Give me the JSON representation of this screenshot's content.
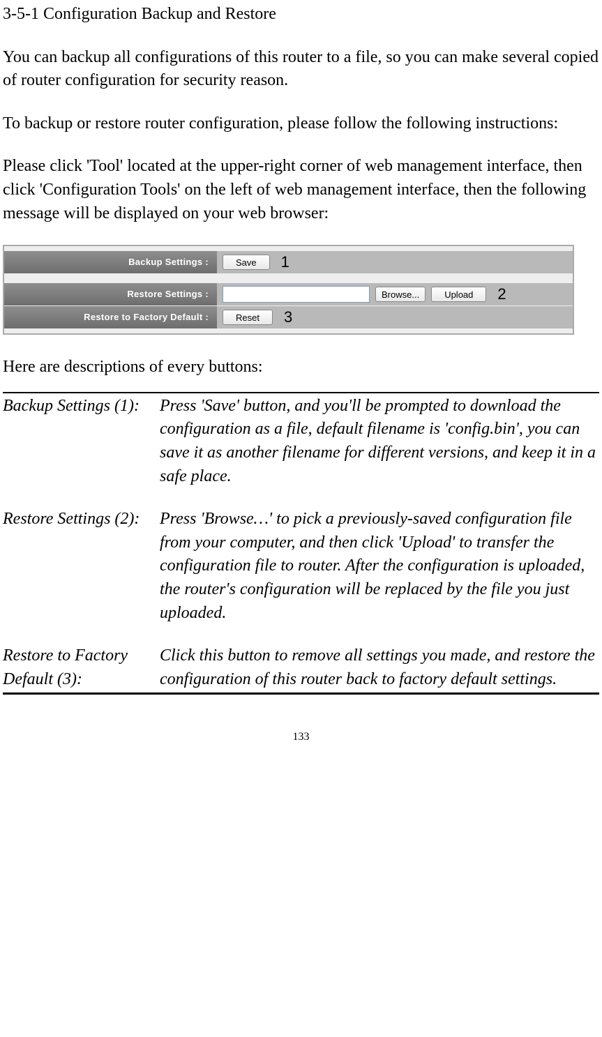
{
  "title": "3-5-1 Configuration Backup and Restore",
  "paragraphs": {
    "p1": "You can backup all configurations of this router to a file, so you can make several copied of router configuration for security reason.",
    "p2": "To backup or restore router configuration, please follow the following instructions:",
    "p3": "Please click 'Tool' located at the upper-right corner of web management interface, then click 'Configuration Tools' on the left of web management interface, then the following message will be displayed on your web browser:"
  },
  "ui": {
    "backup_label": "Backup Settings :",
    "restore_label": "Restore Settings :",
    "factory_label": "Restore to Factory Default :",
    "save_btn": "Save",
    "browse_btn": "Browse...",
    "upload_btn": "Upload",
    "reset_btn": "Reset",
    "marker1": "1",
    "marker2": "2",
    "marker3": "3"
  },
  "desc_intro": "Here are descriptions of every buttons:",
  "descriptions": [
    {
      "term": "Backup Settings (1):",
      "def": "Press 'Save' button, and you'll be prompted to download the configuration as a file, default filename is 'config.bin', you can save it as another filename for different versions, and keep it in a safe place."
    },
    {
      "term": "Restore Settings (2):",
      "def": "Press 'Browse…' to pick a previously-saved configuration file from your computer, and then click 'Upload' to transfer the configuration file to router. After the configuration is uploaded, the router's configuration will be replaced by the file you just uploaded."
    },
    {
      "term": "Restore to Factory Default (3):",
      "def": "Click this button to remove all settings you made, and restore the configuration of this router back to factory default settings."
    }
  ],
  "page_number": "133"
}
